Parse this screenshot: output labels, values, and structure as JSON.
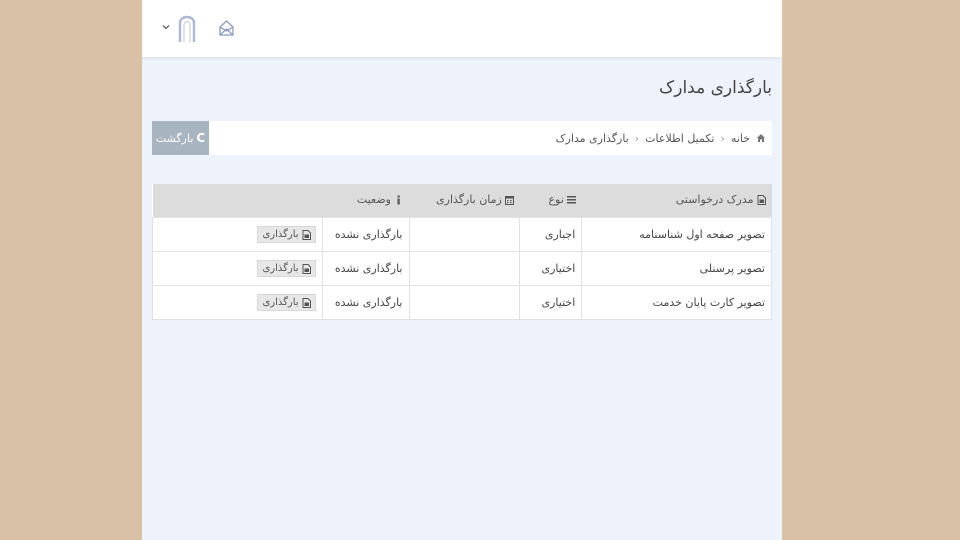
{
  "header": {
    "icons": [
      "chevron-down-icon",
      "user-avatar-icon",
      "home-icon"
    ]
  },
  "page": {
    "title": "بارگذاری مدارک"
  },
  "breadcrumb": {
    "items": [
      "خانه",
      "تکمیل اطلاعات",
      "بارگذاری مدارک"
    ],
    "back_label": "بارگشت",
    "back_icon_letter": "C"
  },
  "table": {
    "headers": [
      "مدرک درخواستی",
      "نوع",
      "زمان بارگذاری",
      "وضعیت"
    ],
    "header_icons": [
      "file-image-icon",
      "list-icon",
      "calendar-icon",
      "info-icon"
    ],
    "rows": [
      {
        "document": "تصویر صفحه اول شناسنامه",
        "type": "اجباری",
        "upload_time": "",
        "status": "بارگذاری نشده",
        "action": "بارگذاری"
      },
      {
        "document": "تصویر پرسنلی",
        "type": "اختیاری",
        "upload_time": "",
        "status": "بارگذاری نشده",
        "action": "بارگذاری"
      },
      {
        "document": "تصویر کارت پایان خدمت",
        "type": "اختیاری",
        "upload_time": "",
        "status": "بارگذاری نشده",
        "action": "بارگذاری"
      }
    ]
  },
  "colors": {
    "outer_background": "#d8c1a7",
    "content_background": "#eef2fa",
    "back_button": "#a9b4c1",
    "table_header": "#dcdcdc"
  }
}
